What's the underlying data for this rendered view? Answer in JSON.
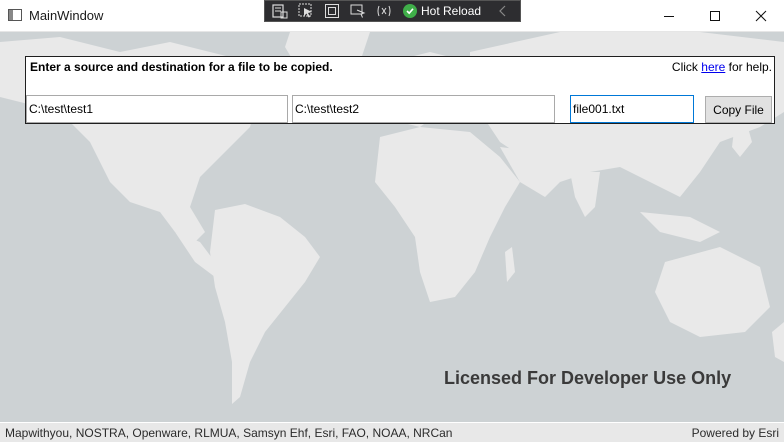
{
  "window": {
    "title": "MainWindow",
    "icons": [
      "app-icon",
      "minimize-icon",
      "maximize-icon",
      "close-icon"
    ]
  },
  "dev_toolbar": {
    "hot_reload_label": "Hot Reload",
    "icons": [
      "live-visual-tree-icon",
      "select-element-icon",
      "display-layout-adorners-icon",
      "track-focus-icon",
      "binding-failures-icon",
      "hot-reload-icon",
      "collapse-icon"
    ],
    "colors": {
      "background": "#2d2d30",
      "hot_reload_green": "#3fae49"
    }
  },
  "panel": {
    "instruction": "Enter a source and destination for a file to be copied.",
    "help_prefix": "Click",
    "help_link": "here",
    "help_suffix": "for help.",
    "source_value": "C:\\test\\test1",
    "destination_value": "C:\\test\\test2",
    "file_value": "file001.txt",
    "copy_button_label": "Copy File"
  },
  "map": {
    "license_text": "Licensed For Developer Use Only",
    "attribution": "Mapwithyou, NOSTRA, Openware, RLMUA, Samsyn Ehf, Esri, FAO, NOAA, NRCan",
    "powered_by": "Powered by Esri",
    "colors": {
      "ocean": "#cdd2d4",
      "land": "#e9e9e9"
    }
  }
}
